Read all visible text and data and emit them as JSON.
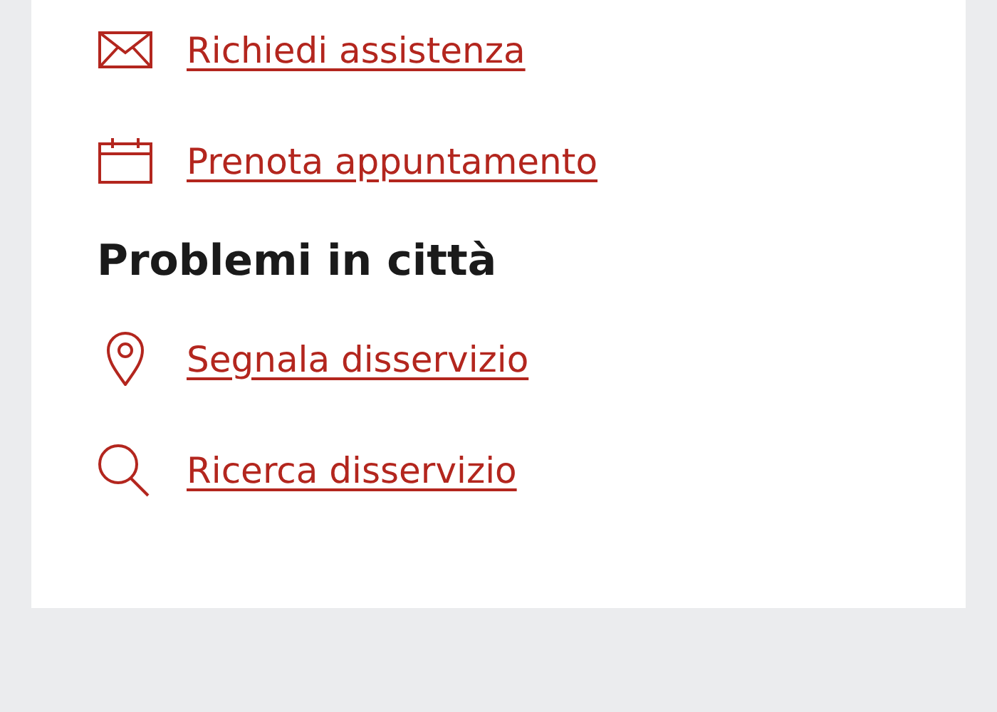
{
  "links": [
    {
      "kind": "mail",
      "label": "Richiedi assistenza"
    },
    {
      "kind": "calendar",
      "label": "Prenota appuntamento"
    }
  ],
  "sections": [
    {
      "title": "Problemi in città",
      "links": [
        {
          "kind": "pin",
          "label": "Segnala disservizio"
        },
        {
          "kind": "search",
          "label": "Ricerca disservizio"
        }
      ]
    }
  ]
}
